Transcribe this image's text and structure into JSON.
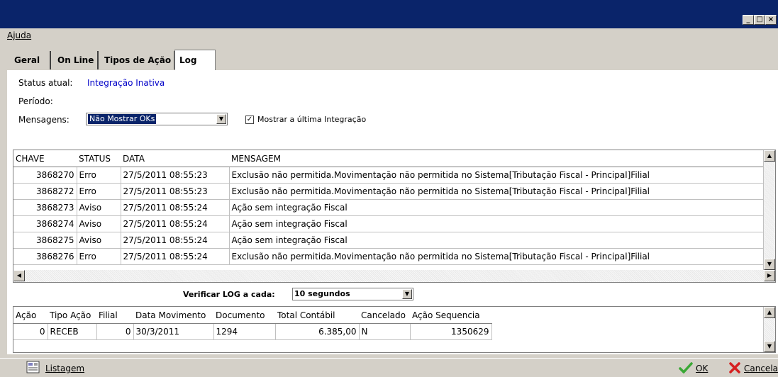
{
  "window": {
    "controls": [
      "_",
      "□",
      "×"
    ]
  },
  "menu": {
    "help": "Ajuda"
  },
  "tabs": [
    {
      "label": "Geral"
    },
    {
      "label": "On Line"
    },
    {
      "label": "Tipos de Ação"
    },
    {
      "label": "Log",
      "active": true
    }
  ],
  "status": {
    "label": "Status atual:",
    "value": "Integração Inativa",
    "period_label": "Período:",
    "messages_label": "Mensagens:",
    "messages_value": "Não Mostrar OKs",
    "last_integration_label": "Mostrar a última Integração",
    "last_integration_checked": true
  },
  "log_grid": {
    "headers": [
      "CHAVE",
      "STATUS",
      "DATA",
      "MENSAGEM"
    ],
    "rows": [
      [
        "3868270",
        "Erro",
        "27/5/2011 08:55:23",
        "Exclusão não permitida.Movimentação não permitida no Sistema[Tributação Fiscal - Principal]Filial"
      ],
      [
        "3868272",
        "Erro",
        "27/5/2011 08:55:23",
        "Exclusão não permitida.Movimentação não permitida no Sistema[Tributação Fiscal - Principal]Filial"
      ],
      [
        "3868273",
        "Aviso",
        "27/5/2011 08:55:24",
        "Ação sem integração Fiscal"
      ],
      [
        "3868274",
        "Aviso",
        "27/5/2011 08:55:24",
        "Ação sem integração Fiscal"
      ],
      [
        "3868275",
        "Aviso",
        "27/5/2011 08:55:24",
        "Ação sem integração Fiscal"
      ],
      [
        "3868276",
        "Erro",
        "27/5/2011 08:55:24",
        "Exclusão não permitida.Movimentação não permitida no Sistema[Tributação Fiscal - Principal]Filial"
      ]
    ]
  },
  "check_log": {
    "label": "Verificar LOG a cada:",
    "value": "10 segundos"
  },
  "detail_grid": {
    "headers": [
      "Ação",
      "Tipo Ação",
      "Filial",
      "Data Movimento",
      "Documento",
      "Total Contábil",
      "Cancelado",
      "Ação Sequencia"
    ],
    "rows": [
      [
        "0",
        "RECEB",
        "0",
        "30/3/2011",
        "1294",
        "6.385,00",
        "N",
        "1350629"
      ]
    ]
  },
  "footer": {
    "listing": "Listagem",
    "ok": "OK",
    "cancel": "Cancela"
  },
  "colors": {
    "titlebar": "#0a246a",
    "link_blue": "#0000c8",
    "ok_green": "#3aa835",
    "cancel_red": "#d62020"
  },
  "icons": {
    "listing": "report-icon",
    "ok": "checkmark-icon",
    "cancel": "x-icon"
  }
}
